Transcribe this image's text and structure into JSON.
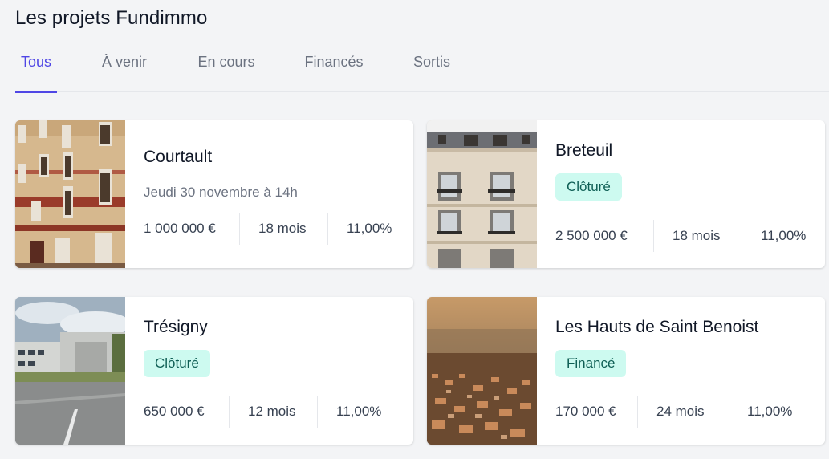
{
  "page": {
    "title": "Les projets Fundimmo"
  },
  "tabs": [
    {
      "label": "Tous",
      "active": true
    },
    {
      "label": "À venir",
      "active": false
    },
    {
      "label": "En cours",
      "active": false
    },
    {
      "label": "Financés",
      "active": false
    },
    {
      "label": "Sortis",
      "active": false
    }
  ],
  "projects": [
    {
      "name": "Courtault",
      "date": "Jeudi 30 novembre à 14h",
      "amount": "1 000 000 €",
      "duration": "18 mois",
      "rate": "11,00%"
    },
    {
      "name": "Breteuil",
      "status": "Clôturé",
      "amount": "2 500 000 €",
      "duration": "18 mois",
      "rate": "11,00%"
    },
    {
      "name": "Trésigny",
      "status": "Clôturé",
      "amount": "650 000 €",
      "duration": "12 mois",
      "rate": "11,00%"
    },
    {
      "name": "Les Hauts de Saint Benoist",
      "status": "Financé",
      "amount": "170 000 €",
      "duration": "24 mois",
      "rate": "11,00%"
    }
  ],
  "colors": {
    "accent": "#4f46e5",
    "badge_bg": "#cdfaf0",
    "badge_text": "#0f5f55"
  }
}
